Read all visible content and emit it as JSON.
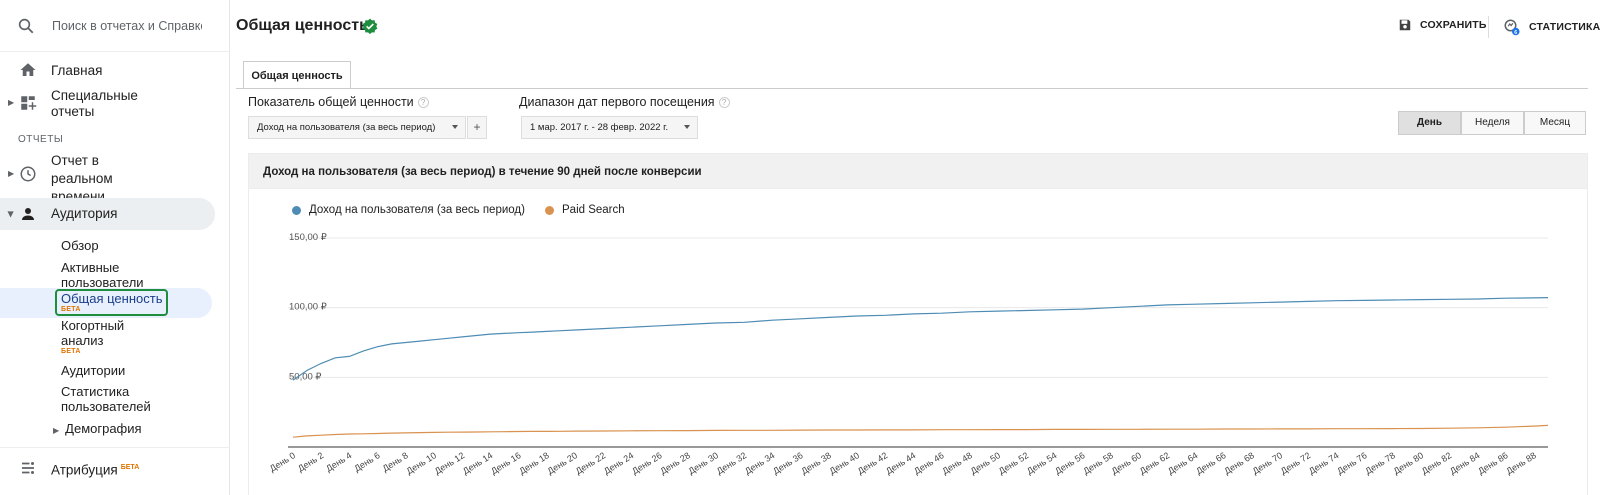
{
  "sidebar": {
    "search_placeholder": "Поиск в отчетах и Справке",
    "home": "Главная",
    "custom": "Специальные отчеты",
    "section": "ОТЧЕТЫ",
    "realtime": "Отчет в реальном времени",
    "audience": "Аудитория",
    "audience_items": [
      {
        "label": "Обзор"
      },
      {
        "label": "Активные пользователи"
      },
      {
        "label": "Общая ценность",
        "badge": "БЕТА"
      },
      {
        "label": "Когортный анализ",
        "badge": "БЕТА"
      },
      {
        "label": "Аудитории"
      },
      {
        "label": "Статистика пользователей"
      },
      {
        "label": "Демография"
      }
    ],
    "attribution": "Атрибуция",
    "attribution_badge": "БЕТА"
  },
  "header": {
    "title": "Общая ценность",
    "save": "СОХРАНИТЬ",
    "insights": "СТАТИСТИКА",
    "insights_count": "6"
  },
  "tab": "Общая ценность",
  "controls": {
    "metric_label": "Показатель общей ценности",
    "metric_value": "Доход на пользователя (за весь период)",
    "daterange_label": "Диапазон дат первого посещения",
    "daterange_value": "1 мар. 2017 г. - 28 февр. 2022 г.",
    "granularity": [
      "День",
      "Неделя",
      "Месяц"
    ],
    "granularity_selected": "День"
  },
  "chart_data": {
    "type": "line",
    "title": "Доход на пользователя (за весь период) в течение 90 дней после конверсии",
    "ylim": [
      0,
      150
    ],
    "y_ticks": [
      "150,00 ₽",
      "100,00 ₽",
      "50,00 ₽"
    ],
    "x_tick_labels": [
      "День 0",
      "День 2",
      "День 4",
      "День 6",
      "День 8",
      "День 10",
      "День 12",
      "День 14",
      "День 16",
      "День 18",
      "День 20",
      "День 22",
      "День 24",
      "День 26",
      "День 28",
      "День 30",
      "День 32",
      "День 34",
      "День 36",
      "День 38",
      "День 40",
      "День 42",
      "День 44",
      "День 46",
      "День 48",
      "День 50",
      "День 52",
      "День 54",
      "День 56",
      "День 58",
      "День 60",
      "День 62",
      "День 64",
      "День 66",
      "День 68",
      "День 70",
      "День 72",
      "День 74",
      "День 76",
      "День 78",
      "День 80",
      "День 82",
      "День 84",
      "День 86",
      "День 88"
    ],
    "x": [
      0,
      1,
      2,
      3,
      4,
      5,
      6,
      7,
      8,
      9,
      10,
      11,
      12,
      13,
      14,
      15,
      16,
      17,
      18,
      19,
      20,
      22,
      24,
      26,
      28,
      30,
      32,
      34,
      36,
      38,
      40,
      42,
      44,
      46,
      48,
      50,
      52,
      54,
      56,
      58,
      60,
      62,
      64,
      66,
      68,
      70,
      72,
      74,
      76,
      78,
      80,
      82,
      84,
      86,
      88,
      89
    ],
    "series": [
      {
        "name": "Доход на пользователя (за весь период)",
        "color": "#4e8cb5",
        "values": [
          48,
          55,
          60,
          64,
          65,
          69,
          72,
          74,
          75,
          76,
          77,
          78,
          79,
          80,
          81,
          81.5,
          82,
          82.5,
          83,
          83.5,
          84,
          85,
          86,
          87,
          88,
          89,
          89.5,
          91,
          92,
          93,
          94,
          94.5,
          95.5,
          96,
          97,
          97.5,
          98,
          98.5,
          99,
          100,
          101,
          102,
          102.5,
          103,
          103.5,
          104,
          104.5,
          105,
          105.2,
          105.5,
          105.8,
          106,
          106.2,
          106.8,
          107,
          107.2
        ]
      },
      {
        "name": "Paid Search",
        "color": "#d9924f",
        "values": [
          7,
          8,
          8.5,
          9,
          9.3,
          9.5,
          9.7,
          10,
          10.1,
          10.3,
          10.5,
          10.6,
          10.7,
          10.8,
          10.9,
          11,
          11.1,
          11.2,
          11.2,
          11.3,
          11.4,
          11.5,
          11.6,
          11.7,
          11.8,
          11.9,
          12,
          12,
          12.1,
          12.2,
          12.2,
          12.3,
          12.3,
          12.4,
          12.4,
          12.5,
          12.5,
          12.6,
          12.6,
          12.7,
          12.7,
          12.8,
          12.8,
          12.9,
          12.9,
          13,
          13,
          13.1,
          13.1,
          13.2,
          13.3,
          13.5,
          13.8,
          14.2,
          15,
          15.5
        ]
      }
    ]
  }
}
